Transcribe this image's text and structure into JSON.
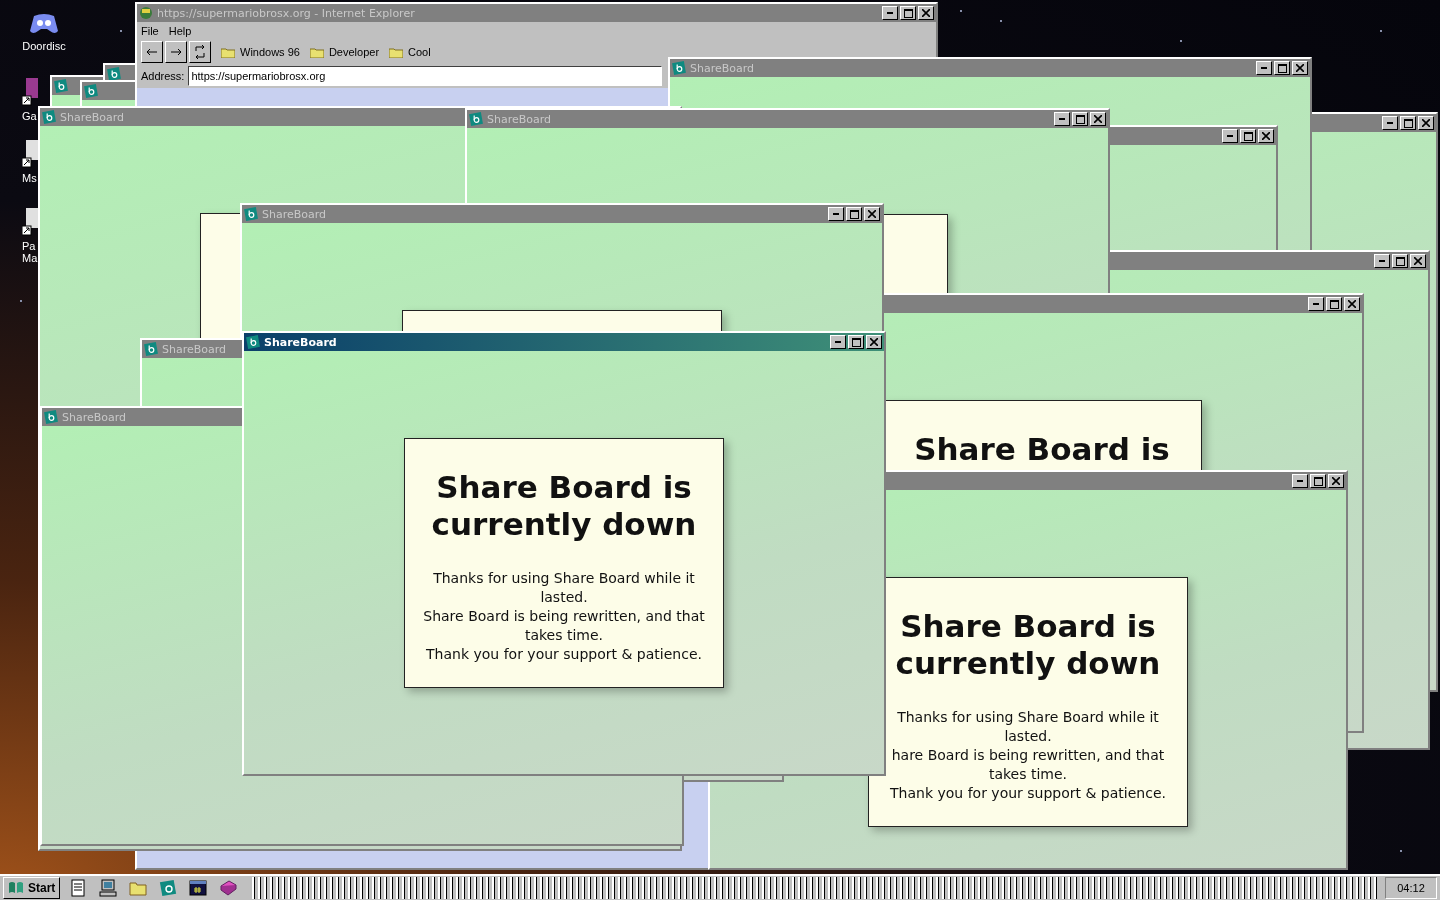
{
  "desktop_icons": [
    {
      "label": "Doordisc"
    },
    {
      "label": "Ga"
    },
    {
      "label": "Ms"
    },
    {
      "label": "Pa Ma"
    }
  ],
  "browser": {
    "title": "https://supermariobrosx.org - Internet Explorer",
    "menu": [
      "File",
      "Help"
    ],
    "bookmarks": [
      "Windows 96",
      "Developer",
      "Cool"
    ],
    "address_label": "Address:",
    "address": "https://supermariobrosx.org"
  },
  "windows": [
    {
      "active": false
    },
    {
      "active": false
    },
    {
      "active": false
    },
    {
      "active": false
    },
    {
      "title": "ShareBoard",
      "active": false
    },
    {
      "active": false
    },
    {
      "active": false
    },
    {
      "title": "ShareBoard",
      "active": false
    },
    {
      "title": "ShareBoard",
      "active": false
    },
    {
      "active": false,
      "card": {
        "heading": "Share Board is"
      }
    },
    {
      "active": false,
      "card": {
        "heading": "Share Board is currently down",
        "lines": [
          "Thanks for using Share Board while it lasted.",
          "hare Board is being rewritten, and that takes time.",
          "Thank you for your support & patience."
        ]
      }
    },
    {
      "title": "ShareBoard",
      "active": false
    },
    {
      "title": "ShareBoard",
      "active": false
    },
    {
      "title": "ShareBoard",
      "active": false
    },
    {
      "title": "ShareBoard",
      "active": true,
      "card": {
        "heading": "Share Board is currently down",
        "lines": [
          "Thanks for using Share Board while it lasted.",
          "Share Board is being rewritten, and that takes time.",
          "Thank you for your support & patience."
        ]
      }
    }
  ],
  "taskbar": {
    "start": "Start",
    "clock": "04:12"
  }
}
